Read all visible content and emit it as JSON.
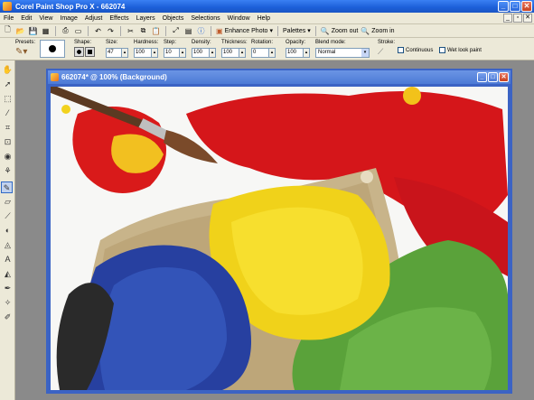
{
  "app": {
    "title": "Corel Paint Shop Pro X - 662074",
    "window_buttons": [
      "minimize-icon",
      "maximize-icon",
      "close-icon"
    ]
  },
  "menu": [
    "File",
    "Edit",
    "View",
    "Image",
    "Adjust",
    "Effects",
    "Layers",
    "Objects",
    "Selections",
    "Window",
    "Help"
  ],
  "toolbar": {
    "enhance_photo": "Enhance Photo",
    "palettes": "Palettes",
    "zoom_out": "Zoom out",
    "zoom_in": "Zoom in"
  },
  "tool_options": {
    "presets_label": "Presets:",
    "shape_label": "Shape:",
    "size_label": "Size:",
    "size_value": "47",
    "hardness_label": "Hardness:",
    "hardness_value": "100",
    "step_label": "Step:",
    "step_value": "10",
    "density_label": "Density:",
    "density_value": "100",
    "thickness_label": "Thickness:",
    "thickness_value": "100",
    "rotation_label": "Rotation:",
    "rotation_value": "0",
    "opacity_label": "Opacity:",
    "opacity_value": "100",
    "blend_mode_label": "Blend mode:",
    "blend_mode_value": "Normal",
    "stroke_label": "Stroke:",
    "continuous_label": "Continuous",
    "wet_look_label": "Wet look paint"
  },
  "document": {
    "title": "662074* @ 100% (Background)"
  },
  "colors": {
    "accent": "#1c5fd8",
    "chrome": "#ece9d8",
    "workspace": "#8a8a8a"
  }
}
